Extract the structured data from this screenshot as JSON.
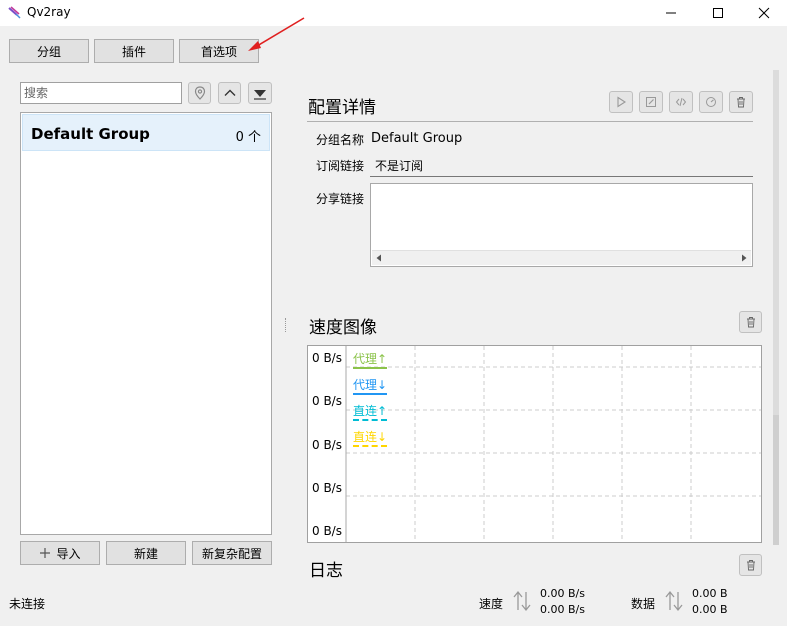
{
  "window": {
    "title": "Qv2ray"
  },
  "toolbar": {
    "groups_label": "分组",
    "plugins_label": "插件",
    "preferences_label": "首选项"
  },
  "search": {
    "placeholder": "搜索"
  },
  "groups": [
    {
      "name": "Default Group",
      "count": "0 个"
    }
  ],
  "bottom_buttons": {
    "import_label": "导入",
    "new_label": "新建",
    "new_complex_label": "新复杂配置"
  },
  "details": {
    "title": "配置详情",
    "group_name_label": "分组名称",
    "group_name_value": "Default Group",
    "subscription_label": "订阅链接",
    "subscription_value": "不是订阅",
    "share_label": "分享链接"
  },
  "speed_chart": {
    "title": "速度图像",
    "y_tick_labels": [
      "0 B/s",
      "0 B/s",
      "0 B/s",
      "0 B/s",
      "0 B/s"
    ],
    "legend": [
      {
        "label": "代理↑",
        "color": "#8bc34a"
      },
      {
        "label": "代理↓",
        "color": "#2196f3"
      },
      {
        "label": "直连↑",
        "color": "#00bcd4"
      },
      {
        "label": "直连↓",
        "color": "#ffd600"
      }
    ]
  },
  "chart_data": {
    "type": "line",
    "title": "速度图像",
    "series": [
      {
        "name": "代理↑",
        "values": []
      },
      {
        "name": "代理↓",
        "values": []
      },
      {
        "name": "直连↑",
        "values": []
      },
      {
        "name": "直连↓",
        "values": []
      }
    ],
    "y_tick_labels": [
      "0 B/s",
      "0 B/s",
      "0 B/s",
      "0 B/s",
      "0 B/s"
    ],
    "grid": true,
    "legend_placement": "top-left"
  },
  "log": {
    "title": "日志"
  },
  "status": {
    "connection": "未连接",
    "speed_label": "速度",
    "speed_up": "0.00 B/s",
    "speed_down": "0.00 B/s",
    "data_label": "数据",
    "data_up": "0.00 B",
    "data_down": "0.00 B"
  }
}
